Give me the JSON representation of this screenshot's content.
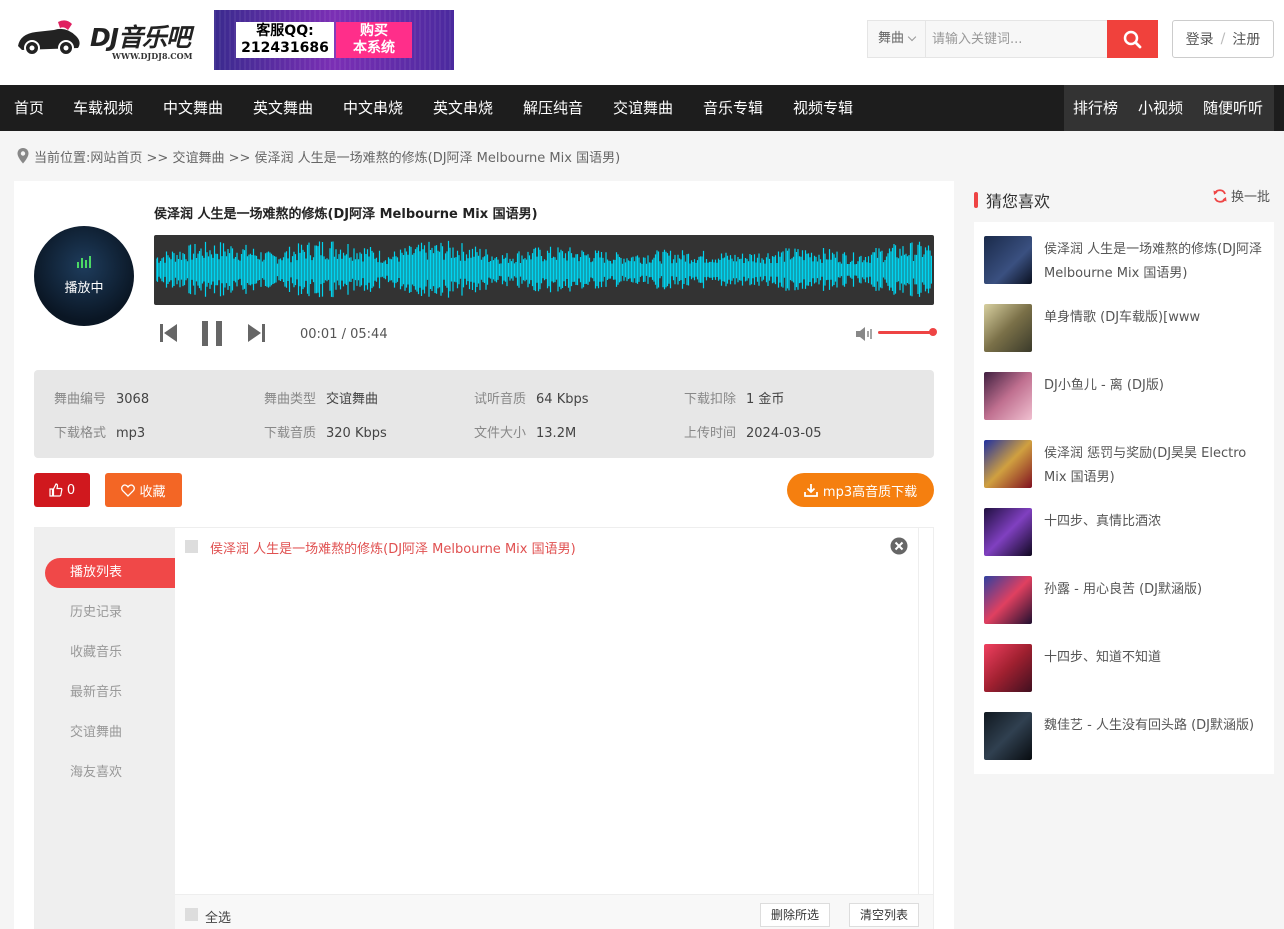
{
  "logo": {
    "brand": "DJ音乐吧",
    "url": "WWW.DJDJ8.COM"
  },
  "banner": {
    "qq_label": "客服QQ:",
    "qq_number": "212431686",
    "buy_line1": "购买",
    "buy_line2": "本系统"
  },
  "search": {
    "category": "舞曲",
    "placeholder": "请输入关键词..."
  },
  "auth": {
    "login": "登录",
    "separator": "/",
    "register": "注册"
  },
  "nav": {
    "items": [
      "首页",
      "车载视频",
      "中文舞曲",
      "英文舞曲",
      "中文串烧",
      "英文串烧",
      "解压纯音",
      "交谊舞曲",
      "音乐专辑",
      "视频专辑"
    ],
    "right_items": [
      "排行榜",
      "小视频",
      "随便听听"
    ]
  },
  "breadcrumb": {
    "prefix": "当前位置:",
    "trail": "网站首页 >> 交谊舞曲 >> 侯泽润 人生是一场难熬的修炼(DJ阿泽 Melbourne Mix 国语男)"
  },
  "player": {
    "status": "播放中",
    "title": "侯泽润 人生是一场难熬的修炼(DJ阿泽 Melbourne Mix 国语男)",
    "current_time": "00:01",
    "time_separator": " / ",
    "total_time": "05:44",
    "volume": 0.95,
    "waveform_color": "#00d4f0"
  },
  "info": [
    {
      "key": "舞曲编号",
      "value": "3068"
    },
    {
      "key": "舞曲类型",
      "value": "交谊舞曲"
    },
    {
      "key": "试听音质",
      "value": "64 Kbps"
    },
    {
      "key": "下载扣除",
      "value": "1 金币"
    },
    {
      "key": "下载格式",
      "value": "mp3"
    },
    {
      "key": "下载音质",
      "value": "320 Kbps"
    },
    {
      "key": "文件大小",
      "value": "13.2M"
    },
    {
      "key": "上传时间",
      "value": "2024-03-05"
    }
  ],
  "actions": {
    "like_count": "0",
    "favorite": "收藏",
    "download": "mp3高音质下载"
  },
  "playlist": {
    "tabs": [
      "播放列表",
      "历史记录",
      "收藏音乐",
      "最新音乐",
      "交谊舞曲",
      "海友喜欢"
    ],
    "songs": [
      "侯泽润 人生是一场难熬的修炼(DJ阿泽 Melbourne Mix 国语男)"
    ],
    "select_all": "全选",
    "delete_selected": "删除所选",
    "clear_list": "清空列表"
  },
  "recommend": {
    "title": "猜您喜欢",
    "refresh": "换一批",
    "items": [
      "侯泽润 人生是一场难熬的修炼(DJ阿泽 Melbourne Mix 国语男)",
      "单身情歌 (DJ车载版)[www",
      "DJ小鱼儿 - 离 (DJ版)",
      "侯泽润 惩罚与奖励(DJ昊昊 Electro Mix 国语男)",
      "十四步、真情比酒浓",
      "孙露 - 用心良苦 (DJ默涵版)",
      "十四步、知道不知道",
      "魏佳艺 - 人生没有回头路 (DJ默涵版)"
    ]
  },
  "colors": {
    "accent": "#f04848",
    "nav_bg": "#1d1d1d",
    "download": "#f57f0f",
    "favorite": "#f36625",
    "like": "#d0181e"
  }
}
